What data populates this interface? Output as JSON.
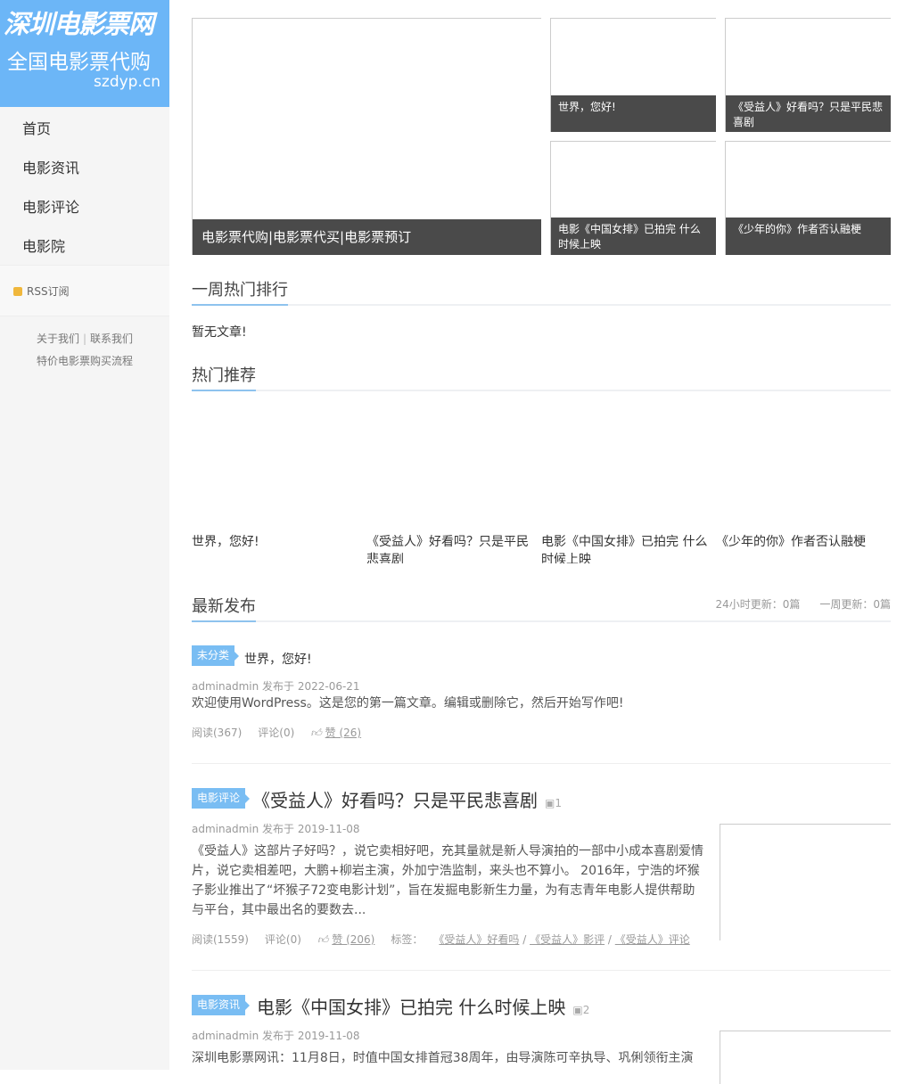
{
  "logo": {
    "title": "深圳电影票网",
    "subtitle": "全国电影票代购",
    "domain": "szdyp.cn"
  },
  "nav": [
    {
      "label": "首页"
    },
    {
      "label": "电影资讯"
    },
    {
      "label": "电影评论"
    },
    {
      "label": "电影院"
    }
  ],
  "rss": {
    "label": "RSS订阅"
  },
  "footer_links": {
    "about": "关于我们",
    "sep": "|",
    "contact": "联系我们",
    "process": "特价电影票购买流程"
  },
  "slider": {
    "main": {
      "caption": "电影票代购|电影票代买|电影票预订"
    },
    "items": [
      {
        "caption": "世界，您好!"
      },
      {
        "caption": "《受益人》好看吗？只是平民悲喜剧"
      },
      {
        "caption": "电影《中国女排》已拍完 什么时候上映"
      },
      {
        "caption": "《少年的你》作者否认融梗"
      }
    ]
  },
  "weekly": {
    "title": "一周热门排行",
    "empty": "暂无文章!"
  },
  "recommend": {
    "title": "热门推荐",
    "items": [
      {
        "title": "世界，您好!"
      },
      {
        "title": "《受益人》好看吗？只是平民悲喜剧"
      },
      {
        "title": "电影《中国女排》已拍完 什么时候上映"
      },
      {
        "title": "《少年的你》作者否认融梗"
      }
    ]
  },
  "latest": {
    "title": "最新发布",
    "stat_24h": "24小时更新：0篇",
    "stat_week": "一周更新：0篇"
  },
  "posts": [
    {
      "category": "未分类",
      "title": "世界，您好!",
      "meta": "adminadmin 发布于 2022-06-21",
      "excerpt": "欢迎使用WordPress。这是您的第一篇文章。编辑或删除它，然后开始写作吧!",
      "reads": "阅读(367)",
      "comments": "评论(0)",
      "likes": "赞 (26)"
    },
    {
      "category": "电影评论",
      "title": "《受益人》好看吗？只是平民悲喜剧",
      "images": "1",
      "meta": "adminadmin 发布于 2019-11-08",
      "excerpt": "《受益人》这部片子好吗？，说它卖相好吧，充其量就是新人导演拍的一部中小成本喜剧爱情片，说它卖相差吧，大鹏+柳岩主演，外加宁浩监制，来头也不算小。 2016年，宁浩的坏猴子影业推出了“坏猴子72变电影计划”，旨在发掘电影新生力量，为有志青年电影人提供帮助与平台，其中最出名的要数去...",
      "reads": "阅读(1559)",
      "comments": "评论(0)",
      "likes": "赞 (206)",
      "tags_label": "标签：",
      "tags": [
        "《受益人》好看吗",
        "《受益人》影评",
        "《受益人》评论"
      ]
    },
    {
      "category": "电影资讯",
      "title": "电影《中国女排》已拍完 什么时候上映",
      "images": "2",
      "meta": "adminadmin 发布于 2019-11-08",
      "excerpt": "深圳电影票网讯：11月8日，时值中国女排首冠38周年，由导演陈可辛执导、巩俐领衔主演"
    }
  ]
}
